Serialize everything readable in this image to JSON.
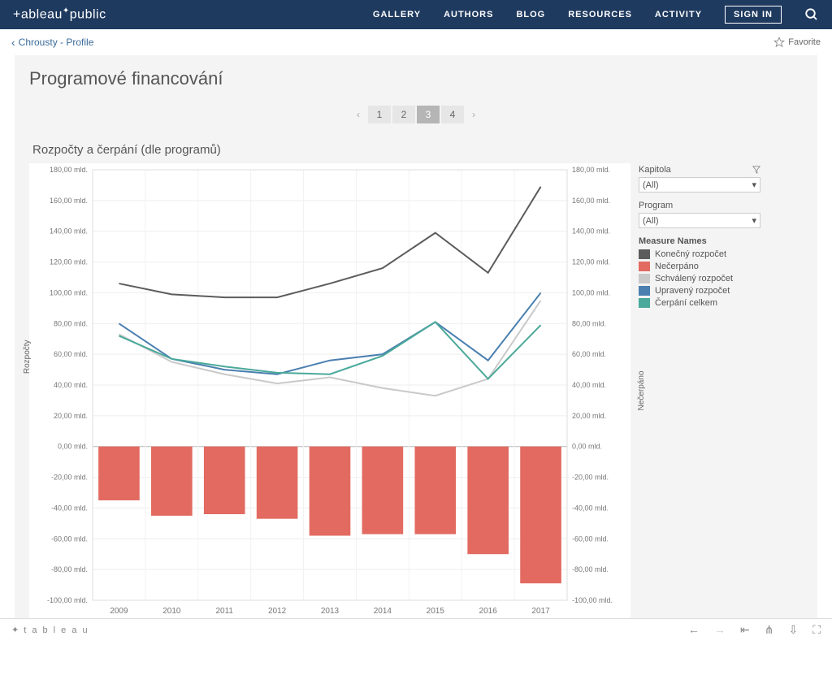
{
  "header": {
    "logo_pre": "+ableau",
    "logo_post": "public",
    "nav": {
      "gallery": "GALLERY",
      "authors": "AUTHORS",
      "blog": "BLOG",
      "resources": "RESOURCES",
      "activity": "ACTIVITY"
    },
    "signin": "SIGN IN"
  },
  "crumb": {
    "back": "Chrousty - Profile",
    "favorite": "Favorite"
  },
  "viz": {
    "title": "Programové financování",
    "pager": {
      "p1": "1",
      "p2": "2",
      "p3": "3",
      "p4": "4"
    },
    "chart_title": "Rozpočty a čerpání (dle programů)"
  },
  "filters": {
    "kapitola_label": "Kapitola",
    "kapitola_value": "(All)",
    "program_label": "Program",
    "program_value": "(All)",
    "legend_title": "Measure Names",
    "legend": {
      "konecny": "Konečný rozpočet",
      "necerpano": "Nečerpáno",
      "schvaleny": "Schválený rozpočet",
      "upraveny": "Upravený rozpočet",
      "cerpani": "Čerpání celkem"
    }
  },
  "axes": {
    "left_label": "Rozpočty",
    "right_label": "Nečerpáno",
    "left_ticks": [
      "180,00 mld.",
      "160,00 mld.",
      "140,00 mld.",
      "120,00 mld.",
      "100,00 mld.",
      "80,00 mld.",
      "60,00 mld.",
      "40,00 mld.",
      "20,00 mld.",
      "0,00 mld.",
      "-20,00 mld.",
      "-40,00 mld.",
      "-60,00 mld.",
      "-80,00 mld.",
      "-100,00 mld."
    ],
    "right_ticks": [
      "180,00 mld.",
      "160,00 mld.",
      "140,00 mld.",
      "120,00 mld.",
      "100,00 mld.",
      "80,00 mld.",
      "60,00 mld.",
      "40,00 mld.",
      "20,00 mld.",
      "0,00 mld.",
      "-20,00 mld.",
      "-40,00 mld.",
      "-60,00 mld.",
      "-80,00 mld.",
      "-100,00 mld."
    ],
    "x_ticks": [
      "2009",
      "2010",
      "2011",
      "2012",
      "2013",
      "2014",
      "2015",
      "2016",
      "2017"
    ]
  },
  "colors": {
    "konecny": "#5c5c5c",
    "necerpano": "#e26a61",
    "schvaleny": "#c9c9c9",
    "upraveny": "#4a7fb0",
    "cerpani": "#4aa99a"
  },
  "chart_data": {
    "type": "bar+line",
    "title": "Rozpočty a čerpání (dle programů)",
    "xlabel": "",
    "ylabel_left": "Rozpočty",
    "ylabel_right": "Nečerpáno",
    "ylim": [
      -100,
      180
    ],
    "categories": [
      "2009",
      "2010",
      "2011",
      "2012",
      "2013",
      "2014",
      "2015",
      "2016",
      "2017"
    ],
    "series": [
      {
        "name": "Konečný rozpočet",
        "kind": "line",
        "color": "#5c5c5c",
        "values": [
          106,
          99,
          97,
          97,
          106,
          116,
          139,
          113,
          169
        ]
      },
      {
        "name": "Schválený rozpočet",
        "kind": "line",
        "color": "#c9c9c9",
        "values": [
          73,
          55,
          47,
          41,
          45,
          38,
          33,
          44,
          95
        ]
      },
      {
        "name": "Upravený rozpočet",
        "kind": "line",
        "color": "#4a7fb0",
        "values": [
          80,
          57,
          50,
          47,
          56,
          60,
          81,
          56,
          100
        ]
      },
      {
        "name": "Čerpání celkem",
        "kind": "line",
        "color": "#4aa99a",
        "values": [
          72,
          57,
          52,
          48,
          47,
          59,
          81,
          44,
          79
        ]
      },
      {
        "name": "Nečerpáno",
        "kind": "bar",
        "color": "#e26a61",
        "values": [
          -35,
          -45,
          -44,
          -47,
          -58,
          -57,
          -57,
          -70,
          -89
        ]
      }
    ]
  }
}
